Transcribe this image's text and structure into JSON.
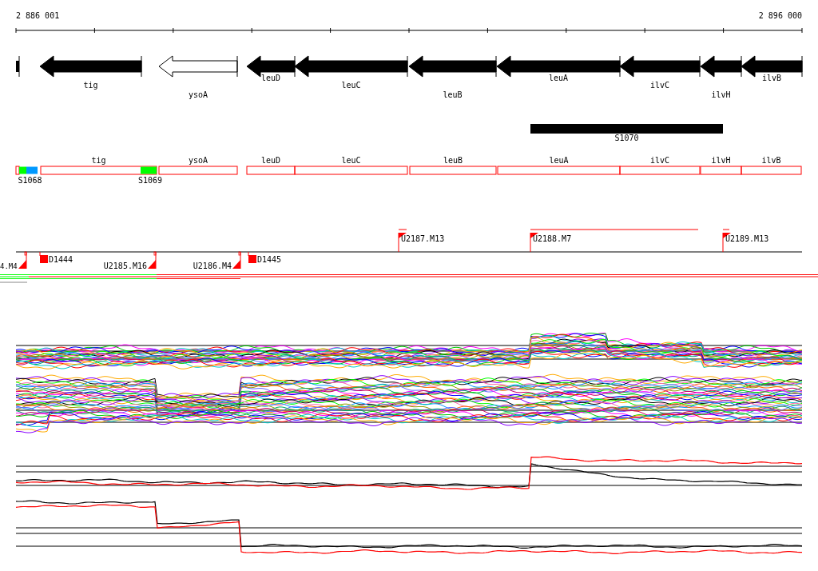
{
  "scale": {
    "start_label": "2 886 001",
    "end_label": "2 896 000"
  },
  "genes": [
    {
      "kind": "partial"
    },
    {
      "kind": "filled",
      "label": "tig"
    },
    {
      "kind": "outlined",
      "label": "ysoA"
    },
    {
      "kind": "filled",
      "label": "leuD"
    },
    {
      "kind": "filled",
      "label": "leuC"
    },
    {
      "kind": "filled",
      "label": "leuB"
    },
    {
      "kind": "filled",
      "label": "leuA"
    },
    {
      "kind": "filled",
      "label": "ilvC"
    },
    {
      "kind": "filled",
      "label": "ilvH"
    },
    {
      "kind": "filled",
      "label": "ilvB"
    }
  ],
  "regions": [
    {
      "label": "S1070"
    }
  ],
  "segments": [
    {
      "kind": "stub"
    },
    {
      "kind": "box",
      "label": "tig"
    },
    {
      "kind": "box",
      "label": "ysoA"
    },
    {
      "kind": "box",
      "label": "leuD"
    },
    {
      "kind": "box",
      "label": "leuC"
    },
    {
      "kind": "box",
      "label": "leuB"
    },
    {
      "kind": "box",
      "label": "leuA"
    },
    {
      "kind": "box",
      "label": "ilvC"
    },
    {
      "kind": "box",
      "label": "ilvH"
    },
    {
      "kind": "box",
      "label": "ilvB"
    }
  ],
  "markers": [
    {
      "label": "S1068",
      "blocks": [
        {
          "color": "#00ff00"
        },
        {
          "color": "#0099ff"
        }
      ]
    },
    {
      "label": "S1069",
      "blocks": [
        {
          "color": "#00ff00"
        }
      ]
    }
  ],
  "probes": [
    {
      "kind": "flag-down",
      "label": "4.M4"
    },
    {
      "kind": "block",
      "label": "D1444"
    },
    {
      "kind": "flag-down",
      "label": "U2185.M16"
    },
    {
      "kind": "flag-down",
      "label": "U2186.M4"
    },
    {
      "kind": "block",
      "label": "D1445"
    },
    {
      "kind": "flag-up",
      "label": "U2187.M13"
    },
    {
      "kind": "flag-up",
      "label": "U2188.M7"
    },
    {
      "kind": "flag-up",
      "label": "U2189.M13"
    }
  ]
}
